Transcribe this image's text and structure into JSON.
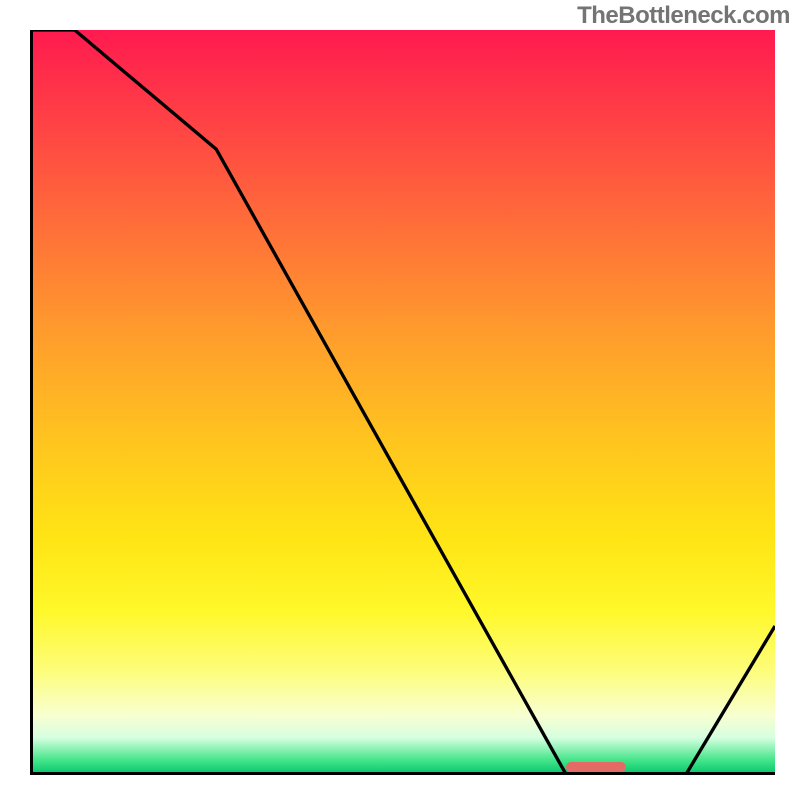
{
  "watermark": "TheBottleneck.com",
  "chart_data": {
    "type": "line",
    "title": "",
    "xlabel": "",
    "ylabel": "",
    "xlim": [
      0,
      100
    ],
    "ylim": [
      0,
      100
    ],
    "x": [
      0,
      6,
      25,
      72,
      79,
      88,
      100
    ],
    "values": [
      100,
      100,
      84,
      0,
      0,
      0,
      20
    ],
    "annotations": [],
    "marker": {
      "x_start": 72,
      "x_end": 80,
      "y": 0
    },
    "gradient_note": "background vertical gradient red→orange→yellow→green; curve overlays bottleneck profile"
  },
  "colors": {
    "curve": "#000000",
    "marker": "#e46a66",
    "axis": "#000000",
    "watermark": "#747474"
  }
}
